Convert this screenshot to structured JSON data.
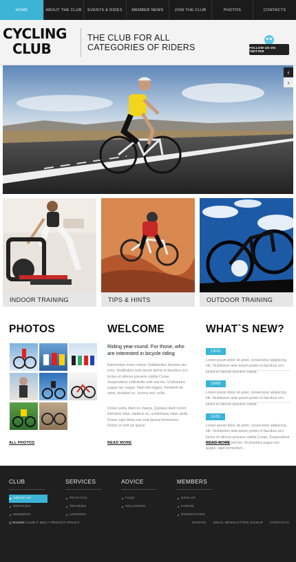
{
  "nav": {
    "items": [
      {
        "label": "HOME",
        "active": true
      },
      {
        "label": "ABOUT THE CLUB",
        "active": false
      },
      {
        "label": "EVENTS & RIDES",
        "active": false
      },
      {
        "label": "MEMBER NEWS",
        "active": false
      },
      {
        "label": "JOIN THE CLUB",
        "active": false
      },
      {
        "label": "PHOTOS",
        "active": false
      },
      {
        "label": "CONTACTS",
        "active": false
      }
    ]
  },
  "header": {
    "logo_line1": "CYCLING",
    "logo_line2": "CLUB",
    "tagline": "THE CLUB FOR ALL CATEGORIES OF RIDERS",
    "twitter_label": "FOLLOW US ON TWITTER"
  },
  "slider": {
    "prev_icon": "‹",
    "next_icon": "›"
  },
  "tiles": [
    {
      "label": "INDOOR TRAINING"
    },
    {
      "label": "TIPS & HINTS"
    },
    {
      "label": "OUTDOOR TRAINING"
    }
  ],
  "photos": {
    "title": "PHOTOS",
    "link": "ALL PHOTOS"
  },
  "welcome": {
    "title": "WELCOME",
    "lead": "Riding year-round. For those, who are interested in bicycle riding",
    "body1": "Elementum lorem metus. Nullafacilisi. Aenean nec eros. Vestibulum ante ipsum primis in faucibus orci luctus et ultrices posuere cubilia Curae; Suspendisse sollicitudin velit sed leo. Ut pharetra augue nec augue. Nam elit magna, hendrerit sit amet, tincidunt ac, viverra sed, nulla.",
    "body2": "Donec porta diam eu massa. Quisque diam lorem, interdum vitae, dapibus ac, scelerisque vitae, pede. Donec eget tellus non erat lacinia fermentum. Donec in velit vel ipsum.",
    "link": "READ MORE"
  },
  "news": {
    "title": "WHAT`S NEW?",
    "items": [
      {
        "date": "13/10",
        "text": "Lorem ipsum dolor sit amet, consectetur adipiscing elit. Vestibulum ante ipsum primis in faucibus orci luctus et ultrices posuere cubilia."
      },
      {
        "date": "10/05",
        "text": "Lorem ipsum dolor sit amet, consectetur adipiscing elit. Vestibulum ante ipsum primis in faucibus orci luctus et ultrices posuere cubilia."
      },
      {
        "date": "11/01",
        "text": "Lorem ipsum dolor sit amet, consectetur adipiscing elit. Vestibulum ante ipsum primis in faucibus orci luctus et ultrices posuere cubilia Curae; Suspendisse sollicitudin velit sed leo. Ut pharetra augue nec augue, eget fermentum."
      }
    ],
    "link": "READ MORE"
  },
  "footer": {
    "club": {
      "title": "CLUB",
      "items": [
        "ABOUT US",
        "SERVICES",
        "MEMBERS",
        "RULES"
      ]
    },
    "services": {
      "title": "SERVICES",
      "items": [
        "PRACTICE",
        "TRAINING",
        "LESSONS"
      ]
    },
    "advice": {
      "title": "ADVICE",
      "items": [
        "FAQS",
        "SOLUTIONS"
      ]
    },
    "members": {
      "title": "MEMBERS",
      "items": [
        "SIGN UP",
        "FORUM",
        "PROMOTIONS"
      ]
    },
    "copyright": "CYCLING CLUB © 2011 • PRIVACY POLICY",
    "bottom_links": [
      "DONATE",
      "EMAIL NEWSLETTER SIGNUP",
      "CONTACTS"
    ]
  },
  "colors": {
    "accent": "#3bb4d6",
    "nav_bg": "#1b1b1b",
    "footer_bg": "#1f1f1f"
  }
}
